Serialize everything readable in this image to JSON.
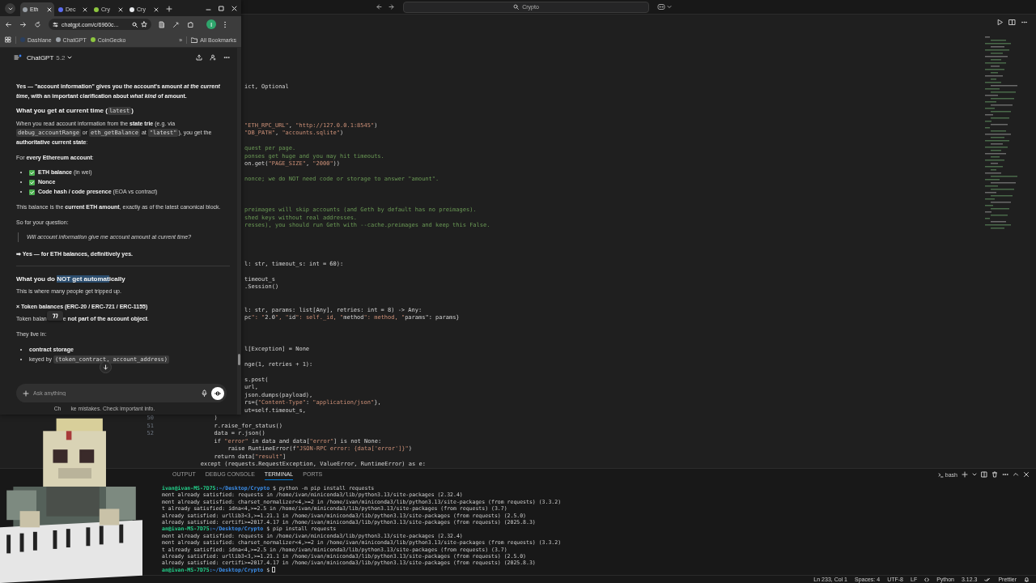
{
  "vscode": {
    "title_bar": {
      "search": "Crypto"
    },
    "editor": {
      "lines": [
        {
          "kind": "code",
          "text": "ict, Optional"
        },
        {
          "kind": "blank"
        },
        {
          "kind": "blank"
        },
        {
          "kind": "blank"
        },
        {
          "kind": "blank"
        },
        {
          "kind": "code",
          "text": "\"ETH_RPC_URL\", \"http://127.0.0.1:8545\")"
        },
        {
          "kind": "code",
          "text": "\"DB_PATH\", \"accounts.sqlite\")"
        },
        {
          "kind": "blank"
        },
        {
          "kind": "comment",
          "text": "quest per page."
        },
        {
          "kind": "comment",
          "text": "ponses get huge and you may hit timeouts."
        },
        {
          "kind": "code",
          "text": "on.get(\"PAGE_SIZE\", \"2000\"))"
        },
        {
          "kind": "blank"
        },
        {
          "kind": "comment",
          "text": "nonce; we do NOT need code or storage to answer \"amount\"."
        },
        {
          "kind": "blank"
        },
        {
          "kind": "blank"
        },
        {
          "kind": "blank"
        },
        {
          "kind": "comment",
          "text": "preimages will skip accounts (and Geth by default has no preimages)."
        },
        {
          "kind": "comment",
          "text": "shed keys without real addresses."
        },
        {
          "kind": "comment",
          "text": "resses), you should run Geth with --cache.preimages and keep this False."
        },
        {
          "kind": "blank"
        },
        {
          "kind": "blank"
        },
        {
          "kind": "blank"
        },
        {
          "kind": "blank"
        },
        {
          "kind": "code",
          "text": "l: str, timeout_s: int = 60):"
        },
        {
          "kind": "blank"
        },
        {
          "kind": "code",
          "text": "timeout_s"
        },
        {
          "kind": "code",
          "text": ".Session()"
        },
        {
          "kind": "blank"
        },
        {
          "kind": "blank"
        },
        {
          "kind": "code",
          "text": "l: str, params: list[Any], retries: int = 8) -> Any:"
        },
        {
          "kind": "code",
          "text": "pc\": \"2.0\", \"id\": self._id, \"method\": method, \"params\": params}"
        },
        {
          "kind": "blank"
        },
        {
          "kind": "blank"
        },
        {
          "kind": "blank"
        },
        {
          "kind": "code",
          "text": "l[Exception] = None"
        },
        {
          "kind": "blank"
        },
        {
          "kind": "code",
          "text": "nge(1, retries + 1):"
        },
        {
          "kind": "blank"
        },
        {
          "kind": "code",
          "text": "s.post("
        },
        {
          "kind": "code",
          "text": "url,"
        },
        {
          "kind": "code",
          "text": "json.dumps(payload),"
        },
        {
          "kind": "code",
          "text": "rs={\"Content-Type\": \"application/json\"},"
        },
        {
          "kind": "code",
          "text": "ut=self.timeout_s,"
        },
        {
          "kind": "full",
          "number": "50",
          "text": "            )"
        },
        {
          "kind": "full",
          "number": "51",
          "text": "            r.raise_for_status()"
        },
        {
          "kind": "full",
          "number": "52",
          "text": "            data = r.json()"
        },
        {
          "kind": "full",
          "text": "            if \"error\" in data and data[\"error\"] is not None:"
        },
        {
          "kind": "full",
          "text": "                raise RuntimeError(f\"JSON-RPC error: {data['error']}\")"
        },
        {
          "kind": "full",
          "text": "            return data[\"result\"]"
        },
        {
          "kind": "full",
          "text": "        except (requests.RequestException, ValueError, RuntimeError) as e:"
        }
      ]
    },
    "panel": {
      "tabs": [
        {
          "label": "OUTPUT",
          "selected": false
        },
        {
          "label": "DEBUG CONSOLE",
          "selected": false
        },
        {
          "label": "TERMINAL",
          "selected": true
        },
        {
          "label": "PORTS",
          "selected": false
        }
      ],
      "shell": "bash",
      "terminal": [
        {
          "kind": "prompt",
          "user": "ivan@ivan-MS-7D75",
          "path": ":~/Desktop/Crypto",
          "command": "$ python -m pip install requests",
          "cursor": false
        },
        {
          "kind": "output",
          "text": "ment already satisfied: requests in /home/ivan/miniconda3/lib/python3.13/site-packages (2.32.4)",
          "cursor": false
        },
        {
          "kind": "output",
          "text": "ment already satisfied: charset_normalizer<4,>=2 in /home/ivan/miniconda3/lib/python3.13/site-packages (from requests) (3.3.2)",
          "cursor": false
        },
        {
          "kind": "output",
          "text": "t already satisfied: idna<4,>=2.5 in /home/ivan/miniconda3/lib/python3.13/site-packages (from requests) (3.7)",
          "cursor": false
        },
        {
          "kind": "output",
          "text": "already satisfied: urllib3<3,>=1.21.1 in /home/ivan/miniconda3/lib/python3.13/site-packages (from requests) (2.5.0)",
          "cursor": false
        },
        {
          "kind": "output",
          "text": "already satisfied: certifi>=2017.4.17 in /home/ivan/miniconda3/lib/python3.13/site-packages (from requests) (2025.8.3)",
          "cursor": false
        },
        {
          "kind": "prompt",
          "user": "an@ivan-MS-7D75",
          "path": ":~/Desktop/Crypto",
          "command": "$ pip install requests",
          "cursor": false
        },
        {
          "kind": "output",
          "text": "ment already satisfied: requests in /home/ivan/miniconda3/lib/python3.13/site-packages (2.32.4)",
          "cursor": false
        },
        {
          "kind": "output",
          "text": "ment already satisfied: charset_normalizer<4,>=2 in /home/ivan/miniconda3/lib/python3.13/site-packages (from requests) (3.3.2)",
          "cursor": false
        },
        {
          "kind": "output",
          "text": "t already satisfied: idna<4,>=2.5 in /home/ivan/miniconda3/lib/python3.13/site-packages (from requests) (3.7)",
          "cursor": false
        },
        {
          "kind": "output",
          "text": "already satisfied: urllib3<3,>=1.21.1 in /home/ivan/miniconda3/lib/python3.13/site-packages (from requests) (2.5.0)",
          "cursor": false
        },
        {
          "kind": "output",
          "text": "already satisfied: certifi>=2017.4.17 in /home/ivan/miniconda3/lib/python3.13/site-packages (from requests) (2025.8.3)",
          "cursor": false
        },
        {
          "kind": "prompt",
          "user": "an@ivan-MS-7D75",
          "path": ":~/Desktop/Crypto",
          "command": "$",
          "cursor": true
        }
      ]
    },
    "status_bar": [
      {
        "kind": "text",
        "text": "Ln 233, Col 1"
      },
      {
        "kind": "text",
        "text": "Spaces: 4"
      },
      {
        "kind": "text",
        "text": "UTF-8"
      },
      {
        "kind": "text",
        "text": "LF"
      },
      {
        "kind": "language",
        "text": "Python"
      },
      {
        "kind": "text",
        "text": "3.12.3"
      },
      {
        "kind": "formatter",
        "text": "Prettier"
      }
    ]
  },
  "browser": {
    "tabs": [
      {
        "label": "Eth",
        "selected": true,
        "color": "#9aa0a6"
      },
      {
        "label": "Dec",
        "selected": false,
        "color": "#5b6cf0"
      },
      {
        "label": "Cry",
        "selected": false,
        "color": "#8dc63f"
      },
      {
        "label": "Cry",
        "selected": false,
        "color": "#e8eaed"
      }
    ],
    "address": "chatgpt.com/c/6960c...",
    "profile": "I",
    "bookmarks": [
      {
        "label": "Dashlane",
        "color": "#2a3f5f"
      },
      {
        "label": "ChatGPT",
        "color": "#9aa0a6"
      },
      {
        "label": "CoinGecko",
        "color": "#8dc63f"
      }
    ],
    "overflow": "»",
    "all_bookmarks": "All Bookmarks",
    "chat": {
      "model": "ChatGPT",
      "version": "5.2",
      "blocks": [
        {
          "kind": "paragraph",
          "segments": [
            {
              "kind": "bold",
              "text": "Yes — \"account information\" gives you the account's amount "
            },
            {
              "kind": "bold-italic",
              "text": "at the current time"
            },
            {
              "kind": "bold",
              "text": ", with an important clarification about "
            },
            {
              "kind": "bold-italic",
              "text": "what kind"
            },
            {
              "kind": "bold",
              "text": " of amount."
            }
          ]
        },
        {
          "kind": "heading",
          "segments": [
            {
              "kind": "plain",
              "text": "What you get at current time (",
              "selected": false
            },
            {
              "kind": "code",
              "text": "latest",
              "selected": false
            },
            {
              "kind": "plain",
              "text": ")",
              "selected": false
            }
          ]
        },
        {
          "kind": "paragraph",
          "segments": [
            {
              "kind": "plain",
              "text": "When you read account information from the "
            },
            {
              "kind": "bold",
              "text": "state trie"
            },
            {
              "kind": "plain",
              "text": " (e.g. via "
            },
            {
              "kind": "code",
              "text": "debug_accountRange"
            },
            {
              "kind": "plain",
              "text": " or "
            },
            {
              "kind": "code",
              "text": "eth_getBalance"
            },
            {
              "kind": "plain",
              "text": " at "
            },
            {
              "kind": "code",
              "text": "\"latest\""
            },
            {
              "kind": "plain",
              "text": "), you get the "
            },
            {
              "kind": "bold",
              "text": "authoritative current state"
            },
            {
              "kind": "plain",
              "text": ":"
            }
          ]
        },
        {
          "kind": "paragraph",
          "segments": [
            {
              "kind": "plain",
              "text": "For "
            },
            {
              "kind": "bold",
              "text": "every Ethereum account"
            },
            {
              "kind": "plain",
              "text": ":"
            }
          ]
        },
        {
          "kind": "bullets",
          "items": [
            {
              "checkmark": true,
              "segments": [
                {
                  "kind": "bold",
                  "text": "ETH balance"
                },
                {
                  "kind": "plain",
                  "text": " (in wei)"
                }
              ]
            },
            {
              "checkmark": true,
              "segments": [
                {
                  "kind": "bold",
                  "text": "Nonce"
                }
              ]
            },
            {
              "checkmark": true,
              "segments": [
                {
                  "kind": "bold",
                  "text": "Code hash / code presence"
                },
                {
                  "kind": "plain",
                  "text": " (EOA vs contract)"
                }
              ]
            }
          ]
        },
        {
          "kind": "paragraph",
          "segments": [
            {
              "kind": "plain",
              "text": "This balance is the "
            },
            {
              "kind": "bold",
              "text": "current ETH amount"
            },
            {
              "kind": "plain",
              "text": ", exactly as of the latest canonical block."
            }
          ]
        },
        {
          "kind": "paragraph",
          "segments": [
            {
              "kind": "plain",
              "text": "So for your question:"
            }
          ]
        },
        {
          "kind": "quote",
          "text": "Will account information give me account amount at current time?"
        },
        {
          "kind": "paragraph",
          "segments": [
            {
              "kind": "bold",
              "text": "➡ Yes — for ETH balances, definitively yes."
            }
          ]
        },
        {
          "kind": "divider"
        },
        {
          "kind": "heading",
          "segments": [
            {
              "kind": "plain",
              "text": "What you do ",
              "selected": false
            },
            {
              "kind": "plain",
              "text": "NOT get automat",
              "selected": true
            },
            {
              "kind": "plain",
              "text": "ically",
              "selected": false
            }
          ]
        },
        {
          "kind": "paragraph",
          "segments": [
            {
              "kind": "plain",
              "text": "This is where many people get tripped up."
            }
          ]
        },
        {
          "kind": "subhead",
          "segments": [
            {
              "kind": "bold",
              "text": "× Token balances (ERC-20 / ERC-721 / ERC-1155)"
            }
          ]
        },
        {
          "kind": "paragraph",
          "segments": [
            {
              "kind": "plain",
              "text": "Token balan"
            },
            {
              "kind": "quote-chip"
            },
            {
              "kind": "plain",
              "text": "e "
            },
            {
              "kind": "bold",
              "text": "not part of the account object"
            },
            {
              "kind": "plain",
              "text": "."
            }
          ]
        },
        {
          "kind": "paragraph",
          "segments": [
            {
              "kind": "plain",
              "text": "They live in:"
            }
          ]
        },
        {
          "kind": "bullets",
          "items": [
            {
              "checkmark": false,
              "segments": [
                {
                  "kind": "bold",
                  "text": "contract storage"
                }
              ]
            },
            {
              "checkmark": false,
              "segments": [
                {
                  "kind": "plain",
                  "text": "keyed by "
                },
                {
                  "kind": "code",
                  "text": "(token_contract, account_address)"
                }
              ]
            }
          ]
        }
      ],
      "composer": {
        "placeholder": "Ask anything"
      },
      "footer": [
        "Ch",
        "ke mistakes. Check important info."
      ]
    }
  }
}
